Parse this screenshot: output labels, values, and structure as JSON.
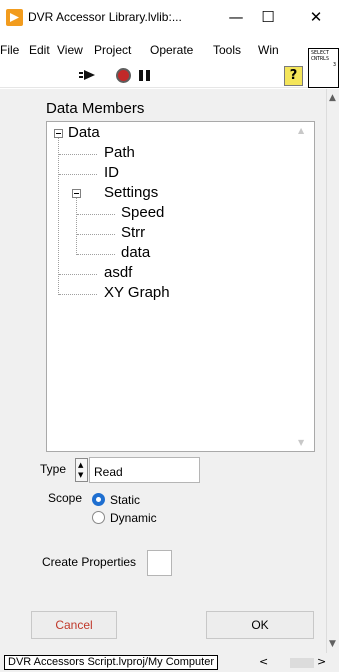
{
  "window": {
    "title": "DVR Accessor Library.lvlib:...",
    "minimize": "—",
    "maximize": "☐",
    "close": "✕"
  },
  "menu": [
    "File",
    "Edit",
    "View",
    "Project",
    "Operate",
    "Tools",
    "Win"
  ],
  "connector_pane": [
    "SELECT",
    "CNTRLS",
    "3"
  ],
  "toolbar": {
    "run_icon": "run-arrow-icon",
    "abort_icon": "abort-icon",
    "pause_icon": "pause-icon",
    "help_label": "?"
  },
  "panel": {
    "data_members_label": "Data Members",
    "tree": [
      {
        "label": "Data",
        "expanded": true
      },
      {
        "label": "Path"
      },
      {
        "label": "ID"
      },
      {
        "label": "Settings",
        "expanded": true
      },
      {
        "label": "Speed"
      },
      {
        "label": "Strr"
      },
      {
        "label": "data"
      },
      {
        "label": "asdf"
      },
      {
        "label": "XY Graph"
      }
    ],
    "type_label": "Type",
    "type_value": "Read",
    "scope_label": "Scope",
    "scope_options": [
      "Static",
      "Dynamic"
    ],
    "scope_selected": "Static",
    "create_properties_label": "Create Properties",
    "create_properties_checked": false,
    "cancel_label": "Cancel",
    "ok_label": "OK"
  },
  "statusbar": {
    "path": "DVR Accessors Script.lvproj/My Computer",
    "left_arrow": "<",
    "right_arrow": ">"
  },
  "colors": {
    "accent_radio": "#1f6fd0",
    "cancel_text": "#c0392b",
    "abort_red": "#c22929",
    "help_yellow": "#f4e55a",
    "app_icon_orange": "#f29c1e"
  }
}
